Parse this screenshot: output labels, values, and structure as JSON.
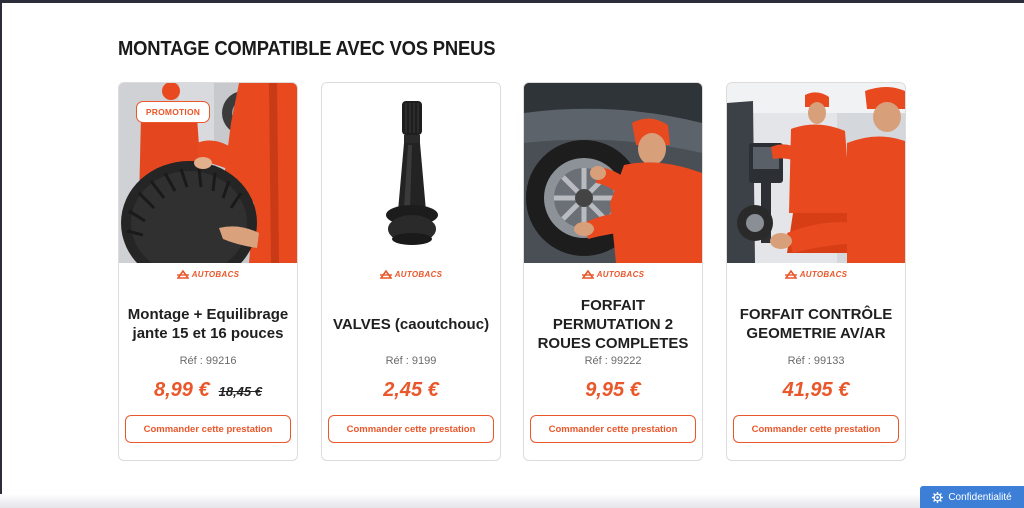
{
  "section": {
    "title": "MONTAGE COMPATIBLE AVEC VOS PNEUS"
  },
  "products": [
    {
      "badge": "PROMOTION",
      "brand": "AUTOBACS",
      "name": "Montage + Equilibrage jante 15 et 16 pouces",
      "ref": "Réf : 99216",
      "price": "8,99 €",
      "old_price": "18,45 €",
      "button": "Commander cette prestation",
      "image_icon": "mechanic-holding-tire-photo"
    },
    {
      "brand": "AUTOBACS",
      "name": "VALVES (caoutchouc)",
      "ref": "Réf : 9199",
      "price": "2,45 €",
      "button": "Commander cette prestation",
      "image_icon": "rubber-valve-photo"
    },
    {
      "brand": "AUTOBACS",
      "name": "FORFAIT PERMUTATION 2 ROUES COMPLETES",
      "ref": "Réf : 99222",
      "price": "9,95 €",
      "button": "Commander cette prestation",
      "image_icon": "mechanic-wheel-swap-photo"
    },
    {
      "brand": "AUTOBACS",
      "name": "FORFAIT CONTRÔLE GEOMETRIE AV/AR",
      "ref": "Réf : 99133",
      "price": "41,95 €",
      "button": "Commander cette prestation",
      "image_icon": "wheel-alignment-photo"
    }
  ],
  "privacy": {
    "label": "Confidentialité",
    "icon": "gear-icon"
  },
  "colors": {
    "accent": "#e9572b",
    "privacy_button": "#3d7fd6",
    "mechanic_suit": "#e8491f"
  }
}
